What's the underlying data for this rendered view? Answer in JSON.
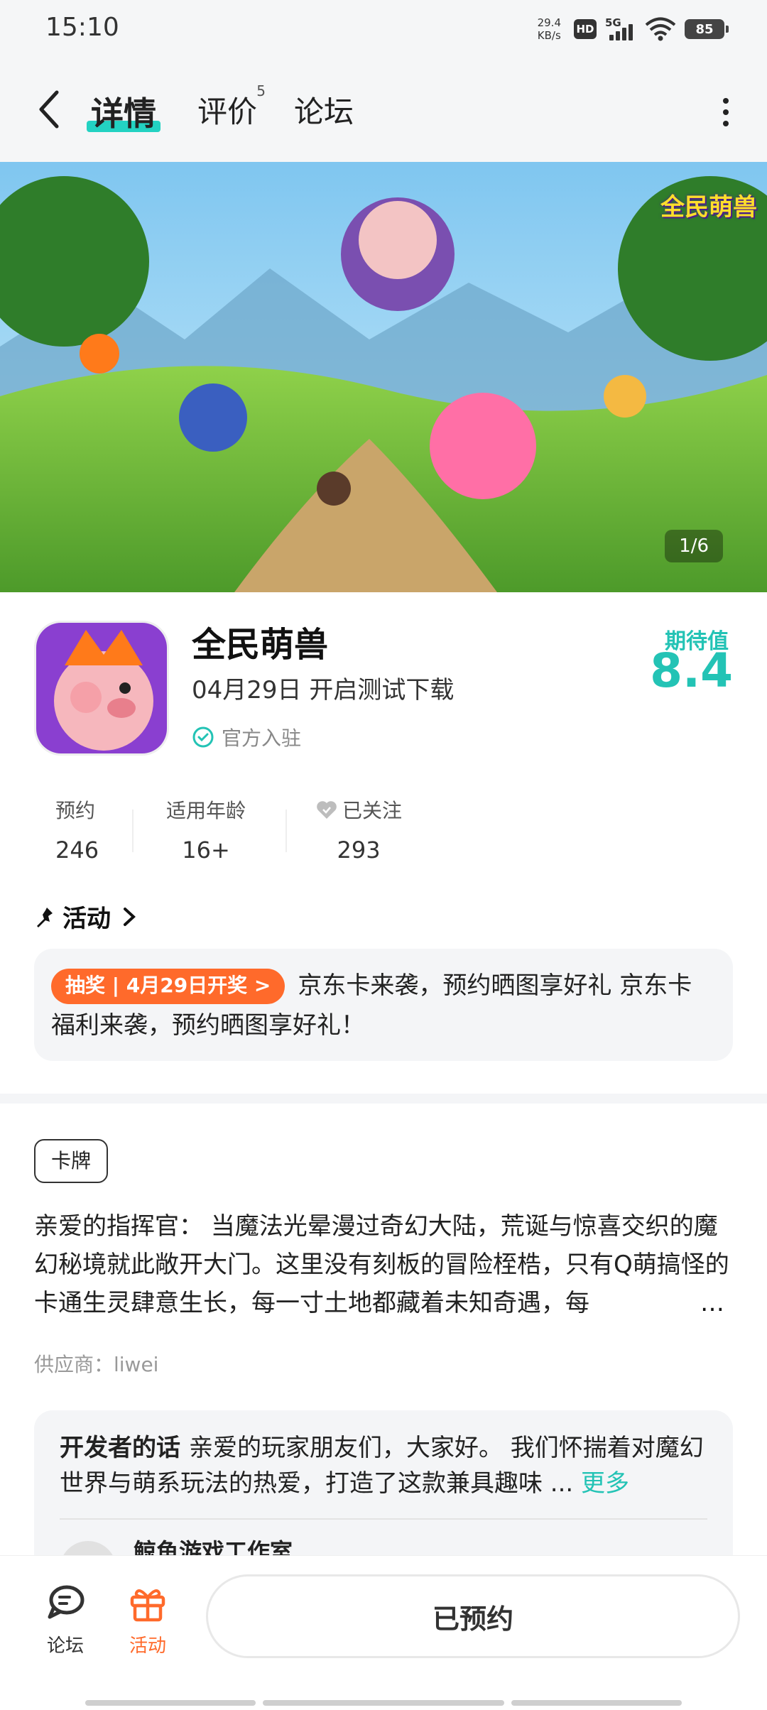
{
  "status_bar": {
    "time": "15:10",
    "net_speed_value": "29.4",
    "net_speed_unit": "KB/s",
    "hd": "HD",
    "network": "5G",
    "battery": "85"
  },
  "header": {
    "tabs": [
      {
        "label": "详情"
      },
      {
        "label": "评价",
        "badge": "5"
      },
      {
        "label": "论坛"
      }
    ]
  },
  "banner": {
    "counter": "1/6",
    "logo_text": "全民萌兽"
  },
  "app": {
    "name": "全民萌兽",
    "date_line": "04月29日 开启测试下载",
    "official": "官方入驻",
    "expect_label": "期待值",
    "expect_score": "8.4"
  },
  "stats": [
    {
      "label": "预约",
      "value": "246"
    },
    {
      "label": "适用年龄",
      "value": "16+"
    },
    {
      "label": "已关注",
      "value": "293"
    }
  ],
  "activity": {
    "title": "活动",
    "badge": "抽奖 | 4月29日开奖 >",
    "text": "京东卡来袭，预约晒图享好礼 京东卡福利来袭，预约晒图享好礼！"
  },
  "tag": "卡牌",
  "description": "亲爱的指挥官： 当魔法光晕漫过奇幻大陆，荒诞与惊喜交织的魔幻秘境就此敞开大门。这里没有刻板的冒险桎梏，只有Q萌搞怪的卡通生灵肆意生长，每一寸土地都藏着未知奇遇，每",
  "description_ellipsis": "…",
  "supplier": "供应商：liwei",
  "developer": {
    "heading": "开发者的话",
    "text": "亲爱的玩家朋友们，大家好。 我们怀揣着对魔幻世界与萌系玩法的热爱，打造了这款兼具趣味 ...",
    "more": "更多",
    "studio": "鲸鱼游戏工作室"
  },
  "bottom_bar": {
    "forum": "论坛",
    "activity": "活动",
    "reserve": "已预约"
  },
  "colors": {
    "accent": "#23c3b5",
    "orange": "#ff6a2b"
  }
}
